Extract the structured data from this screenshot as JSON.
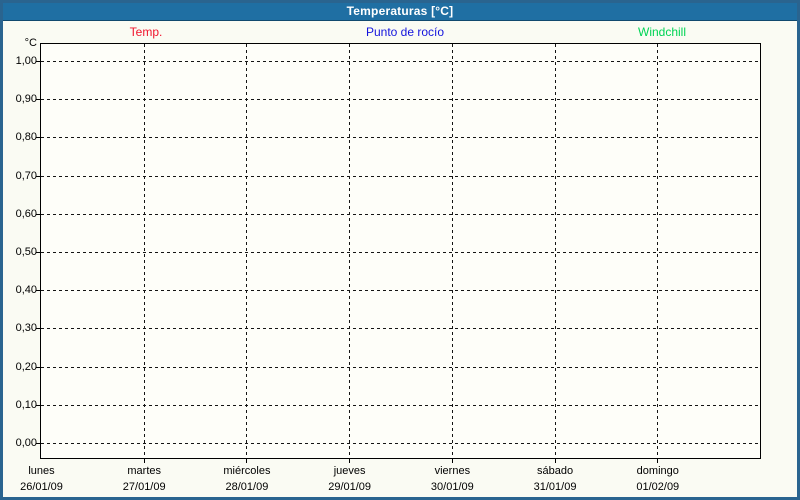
{
  "window": {
    "title": "Temperaturas [°C]"
  },
  "colors": {
    "titlebar_bg": "#1f6fa3",
    "titlebar_text": "#ffffff",
    "frame_border": "#2a648f",
    "page_bg": "#fafbf3",
    "plot_bg": "#fefef9",
    "gridline": "#141414",
    "temp_red": "#f0142d",
    "dewpoint_blue": "#1414dd",
    "windchill_green": "#00d455"
  },
  "chart_data": {
    "type": "line",
    "title": "Temperaturas [°C]",
    "ylabel": "°C",
    "ylim": [
      0.0,
      1.0
    ],
    "ytick_step": 0.1,
    "decimal_separator": ",",
    "ytick_labels_top_to_bottom": [
      "1,00",
      "0,90",
      "0,80",
      "0,70",
      "0,60",
      "0,50",
      "0,40",
      "0,30",
      "0,20",
      "0,10",
      "0,00"
    ],
    "grid": "dashed",
    "legend_position": "top",
    "x_axis": {
      "days": [
        {
          "day_name": "lunes",
          "date": "26/01/09"
        },
        {
          "day_name": "martes",
          "date": "27/01/09"
        },
        {
          "day_name": "miércoles",
          "date": "28/01/09"
        },
        {
          "day_name": "jueves",
          "date": "29/01/09"
        },
        {
          "day_name": "viernes",
          "date": "30/01/09"
        },
        {
          "day_name": "sábado",
          "date": "31/01/09"
        },
        {
          "day_name": "domingo",
          "date": "01/02/09"
        }
      ]
    },
    "series": [
      {
        "name": "Temp.",
        "color": "#f0142d",
        "values": []
      },
      {
        "name": "Punto de rocío",
        "color": "#1414dd",
        "values": []
      },
      {
        "name": "Windchill",
        "color": "#00d455",
        "values": []
      }
    ],
    "note": "plot area is empty - no data lines drawn"
  }
}
